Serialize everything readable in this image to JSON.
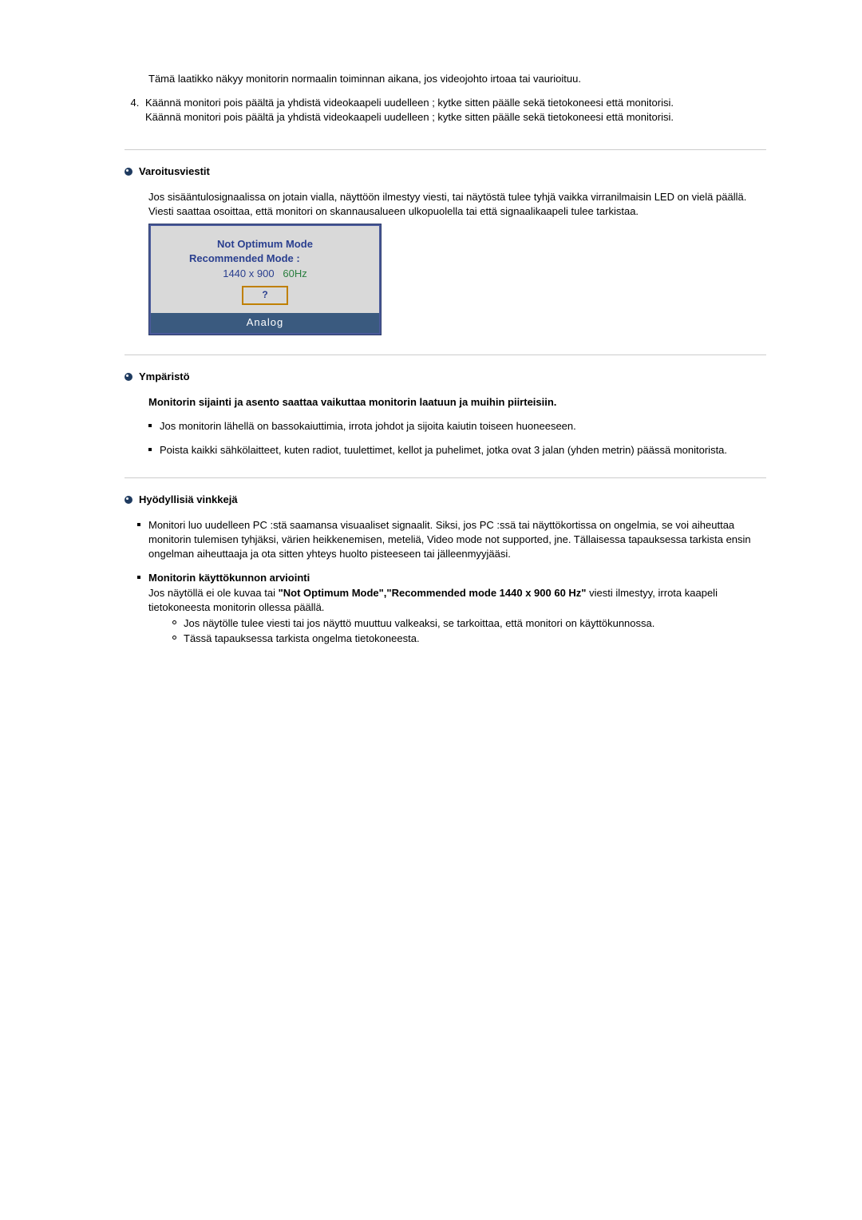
{
  "intro": {
    "box_note": "Tämä laatikko näkyy monitorin normaalin toiminnan aikana, jos videojohto irtoaa tai vaurioituu.",
    "step4_a": "Käännä monitori pois päältä ja yhdistä videokaapeli uudelleen ; kytke sitten päälle sekä tietokoneesi että monitorisi.",
    "step4_b": "Käännä monitori pois päältä ja yhdistä videokaapeli uudelleen ; kytke sitten päälle sekä tietokoneesi että monitorisi."
  },
  "warning": {
    "title": "Varoitusviestit",
    "p1": "Jos sisääntulosignaalissa on jotain vialla, näyttöön ilmestyy viesti, tai näytöstä tulee tyhjä vaikka virranilmaisin LED on vielä päällä.",
    "p2": "Viesti saattaa osoittaa, että monitori on skannausalueen ulkopuolella tai että signaalikaapeli tulee tarkistaa."
  },
  "popup": {
    "line1": "Not Optimum Mode",
    "line2": "Recommended Mode :",
    "resolution": "1440 x 900",
    "hz": "60Hz",
    "button": "?",
    "footer": "Analog"
  },
  "environment": {
    "title": "Ympäristö",
    "subhead": "Monitorin sijainti ja asento saattaa vaikuttaa monitorin laatuun ja muihin piirteisiin.",
    "b1": "Jos monitorin lähellä on bassokaiuttimia, irrota johdot ja sijoita kaiutin toiseen huoneeseen.",
    "b2": "Poista kaikki sähkölaitteet, kuten radiot, tuulettimet, kellot ja puhelimet, jotka ovat 3 jalan (yhden metrin) päässä monitorista."
  },
  "tips": {
    "title": "Hyödyllisiä vinkkejä",
    "b1": "Monitori luo uudelleen PC :stä saamansa visuaaliset signaalit. Siksi, jos PC :ssä tai näyttökortissa on ongelmia, se voi aiheuttaa monitorin tulemisen tyhjäksi, värien heikkenemisen, meteliä, Video mode not supported, jne. Tällaisessa tapauksessa tarkista ensin ongelman aiheuttaaja ja ota sitten yhteys huolto pisteeseen tai jälleenmyyjääsi.",
    "b2_bold": "Monitorin käyttökunnon arviointi",
    "b2_pre": "Jos näytöllä ei ole kuvaa tai ",
    "b2_msg": "\"Not Optimum Mode\",\"Recommended mode 1440 x 900 60 Hz\"",
    "b2_post": " viesti ilmestyy, irrota kaapeli tietokoneesta monitorin ollessa päällä.",
    "b2_s1": "Jos näytölle tulee viesti tai jos näyttö muuttuu valkeaksi, se tarkoittaa, että monitori on käyttökunnossa.",
    "b2_s2": "Tässä tapauksessa tarkista ongelma tietokoneesta."
  }
}
